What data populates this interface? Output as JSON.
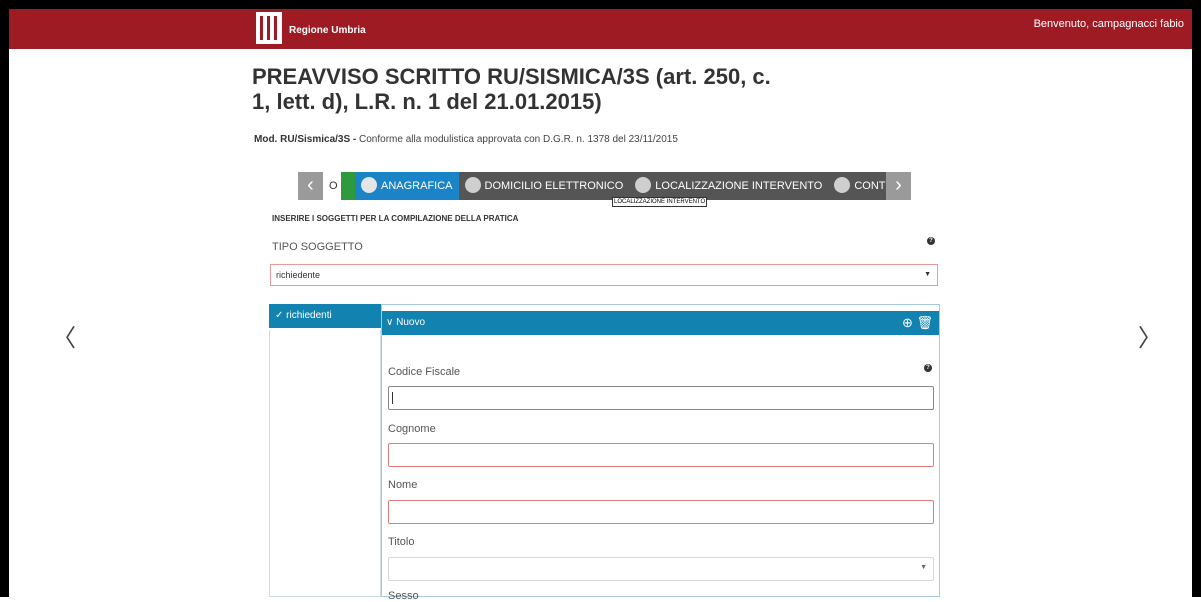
{
  "header": {
    "logo_text": "Regione Umbria",
    "welcome": "Benvenuto, campagnacci fabio"
  },
  "page": {
    "title": "PREAVVISO SCRITTO RU/SISMICA/3S (art. 250, c. 1, lett. d), L.R. n. 1 del 21.01.2015)",
    "subtitle_bold": "Mod. RU/Sismica/3S -",
    "subtitle_text": " Conforme alla modulistica approvata con D.G.R. n. 1378 del  23/11/2015"
  },
  "steps": {
    "prev_icon": "chevron-left-icon",
    "next_icon": "chevron-right-icon",
    "items": [
      {
        "label": "O"
      },
      {
        "label": "ANAGRAFICA"
      },
      {
        "label": "DOMICILIO ELETTRONICO"
      },
      {
        "label": "LOCALIZZAZIONE INTERVENTO"
      },
      {
        "label": "CONTENUTO"
      }
    ],
    "tooltip": "LOCALIZZAZIONE INTERVENTO"
  },
  "form": {
    "section_heading": "INSERIRE I SOGGETTI PER LA COMPILAZIONE DELLA PRATICA",
    "tipo_soggetto_label": "TIPO SOGGETTO",
    "tipo_soggetto_value": "richiedente",
    "side_tab": "✓  richiedenti",
    "panel_title": "∨ Nuovo",
    "panel_tools": "⊕ 🗑",
    "fields": {
      "codice_fiscale": "Codice Fiscale",
      "cognome": "Cognome",
      "nome": "Nome",
      "titolo": "Titolo",
      "sesso": "Sesso"
    }
  },
  "nav": {
    "left": "〈",
    "right": "〉"
  },
  "colors": {
    "brand": "#9e1b24",
    "accent": "#1283b0",
    "active_step": "#1b84c6",
    "required_border": "#e07b7b"
  }
}
